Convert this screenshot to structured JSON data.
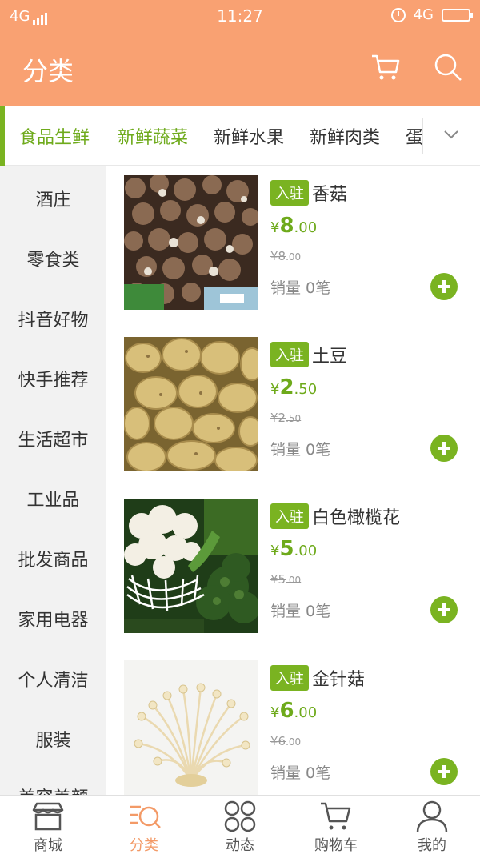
{
  "status_bar": {
    "network_left": "4G",
    "time": "11:27",
    "network_right": "4G"
  },
  "header": {
    "title": "分类",
    "icons": [
      "cart-icon",
      "search-icon"
    ]
  },
  "tabs": [
    {
      "label": "食品生鲜",
      "active": false,
      "primary": true
    },
    {
      "label": "新鲜蔬菜",
      "active": true
    },
    {
      "label": "新鲜水果",
      "active": false
    },
    {
      "label": "新鲜肉类",
      "active": false
    },
    {
      "label": "蛋",
      "active": false
    }
  ],
  "sidebar": {
    "items": [
      "酒庄",
      "零食类",
      "抖音好物",
      "快手推荐",
      "生活超市",
      "工业品",
      "批发商品",
      "家用电器",
      "个人清洁",
      "服装",
      "美容美颜"
    ]
  },
  "products": [
    {
      "badge": "入驻",
      "name": "香菇",
      "currency": "¥",
      "price_int": "8",
      "price_dec": ".00",
      "old_int": "¥8",
      "old_dec": ".00",
      "sales": "销量 0笔",
      "image": "mushroom"
    },
    {
      "badge": "入驻",
      "name": "土豆",
      "currency": "¥",
      "price_int": "2",
      "price_dec": ".50",
      "old_int": "¥2",
      "old_dec": ".50",
      "sales": "销量 0笔",
      "image": "potato"
    },
    {
      "badge": "入驻",
      "name": "白色橄榄花",
      "currency": "¥",
      "price_int": "5",
      "price_dec": ".00",
      "old_int": "¥5",
      "old_dec": ".00",
      "sales": "销量 0笔",
      "image": "cauliflower"
    },
    {
      "badge": "入驻",
      "name": "金针菇",
      "currency": "¥",
      "price_int": "6",
      "price_dec": ".00",
      "old_int": "¥6",
      "old_dec": ".00",
      "sales": "销量 0笔",
      "image": "enoki"
    }
  ],
  "bottom_nav": [
    {
      "label": "商城",
      "icon": "shop-icon",
      "active": false
    },
    {
      "label": "分类",
      "icon": "category-search-icon",
      "active": true
    },
    {
      "label": "动态",
      "icon": "grid-icon",
      "active": false
    },
    {
      "label": "购物车",
      "icon": "cart-icon",
      "active": false
    },
    {
      "label": "我的",
      "icon": "user-icon",
      "active": false
    }
  ],
  "colors": {
    "header": "#f9a172",
    "accent_green": "#7ab321",
    "active_nav": "#f39a67"
  }
}
